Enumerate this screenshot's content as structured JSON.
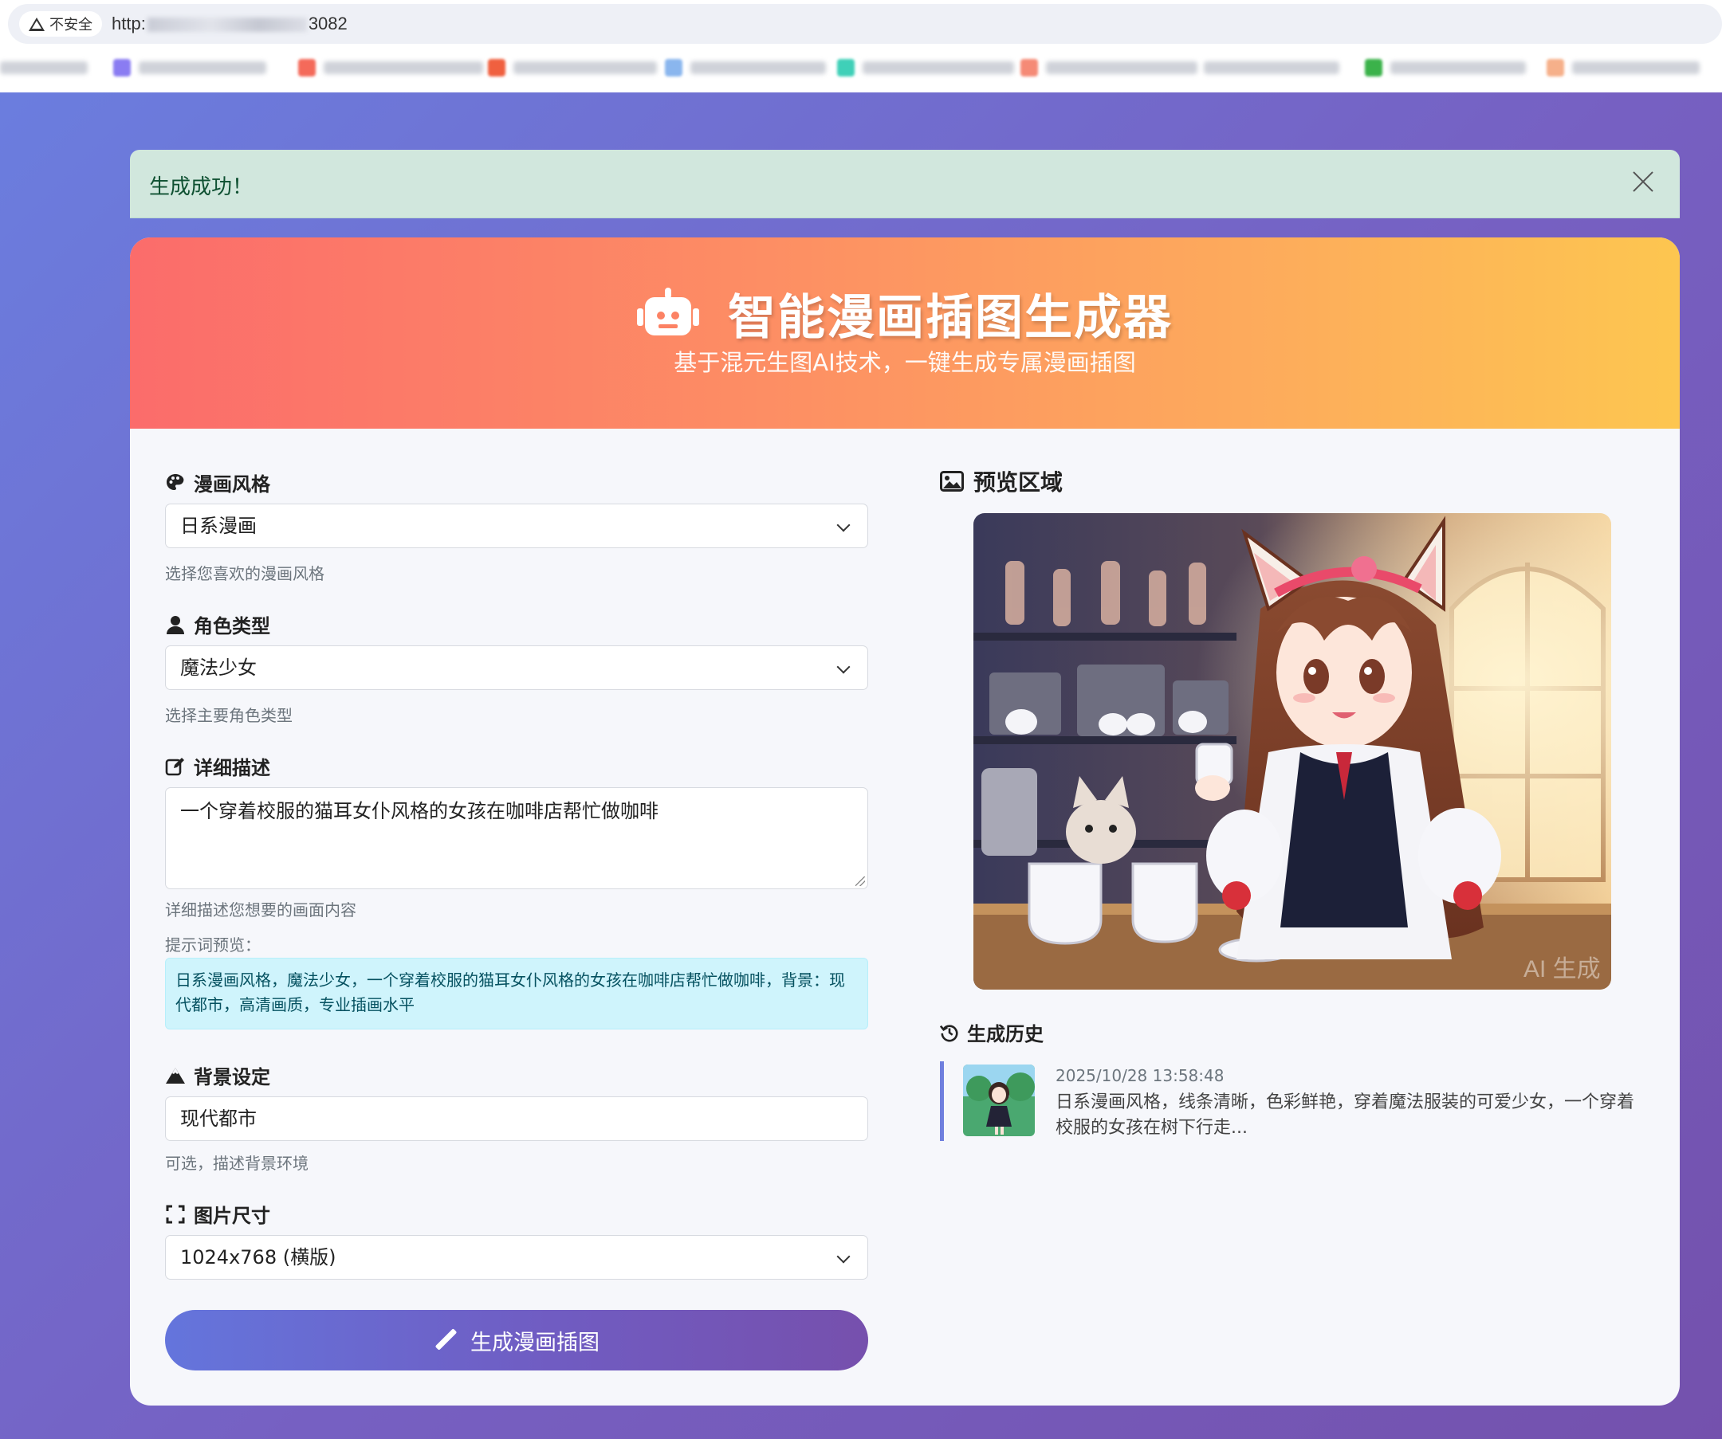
{
  "browser": {
    "security_label": "不安全",
    "url_prefix": "http:",
    "url_suffix": "3082"
  },
  "alert": {
    "message": "生成成功！"
  },
  "hero": {
    "title": "智能漫画插图生成器",
    "subtitle": "基于混元生图AI技术，一键生成专属漫画插图",
    "icon": "robot-icon"
  },
  "form": {
    "style": {
      "label": "漫画风格",
      "value": "日系漫画",
      "hint": "选择您喜欢的漫画风格",
      "icon": "palette-icon"
    },
    "character": {
      "label": "角色类型",
      "value": "魔法少女",
      "hint": "选择主要角色类型",
      "icon": "user-icon"
    },
    "description": {
      "label": "详细描述",
      "value": "一个穿着校服的猫耳女仆风格的女孩在咖啡店帮忙做咖啡",
      "hint": "详细描述您想要的画面内容",
      "icon": "edit-icon"
    },
    "prompt_preview": {
      "label": "提示词预览：",
      "text": "日系漫画风格，魔法少女，一个穿着校服的猫耳女仆风格的女孩在咖啡店帮忙做咖啡，背景：现代都市，高清画质，专业插画水平"
    },
    "background": {
      "label": "背景设定",
      "value": "现代都市",
      "hint": "可选，描述背景环境",
      "icon": "mountain-icon"
    },
    "size": {
      "label": "图片尺寸",
      "value": "1024x768 (横版)",
      "icon": "expand-icon"
    },
    "submit_label": "生成漫画插图"
  },
  "preview": {
    "label": "预览区域",
    "icon": "image-icon",
    "watermark": "AI 生成"
  },
  "history": {
    "label": "生成历史",
    "icon": "history-icon",
    "items": [
      {
        "time": "2025/10/28 13:58:48",
        "desc": "日系漫画风格，线条清晰，色彩鲜艳，穿着魔法服装的可爱少女，一个穿着校服的女孩在树下行走..."
      }
    ]
  },
  "colors": {
    "accent": "#6f7fde",
    "hero_start": "#fb6c6b",
    "hero_end": "#fdc650",
    "success_bg": "#d1e7dd",
    "info_bg": "#cff4fc"
  }
}
